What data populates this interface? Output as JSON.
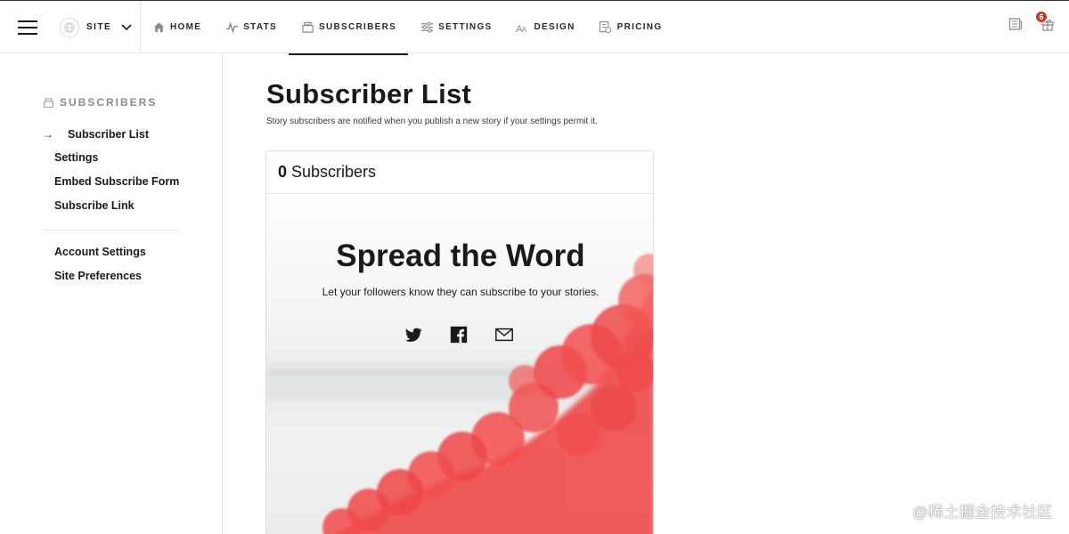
{
  "topbar": {
    "site_label": "SITE",
    "nav": [
      {
        "label": "HOME",
        "icon": "home-icon"
      },
      {
        "label": "STATS",
        "icon": "stats-icon"
      },
      {
        "label": "SUBSCRIBERS",
        "icon": "subscribers-icon",
        "active": true
      },
      {
        "label": "SETTINGS",
        "icon": "settings-icon"
      },
      {
        "label": "DESIGN",
        "icon": "design-icon"
      },
      {
        "label": "PRICING",
        "icon": "pricing-icon"
      }
    ],
    "notification_count": "6"
  },
  "sidebar": {
    "heading": "SUBSCRIBERS",
    "items": [
      {
        "label": "Subscriber List",
        "active": true
      },
      {
        "label": "Settings"
      },
      {
        "label": "Embed Subscribe Form"
      },
      {
        "label": "Subscribe Link"
      }
    ],
    "secondary": [
      {
        "label": "Account Settings"
      },
      {
        "label": "Site Preferences"
      }
    ]
  },
  "main": {
    "title": "Subscriber List",
    "subtitle": "Story subscribers are notified when you publish a new story if your settings permit it.",
    "card": {
      "count": "0",
      "count_label": "Subscribers",
      "promo_title": "Spread the Word",
      "promo_sub": "Let your followers know they can subscribe to your stories.",
      "share_icons": [
        "twitter-icon",
        "facebook-icon",
        "email-icon"
      ]
    }
  },
  "watermark": "@稀土掘金技术社区",
  "colors": {
    "accent_smoke": "#f04848",
    "badge": "#c0392b",
    "text": "#1a1a1a"
  }
}
